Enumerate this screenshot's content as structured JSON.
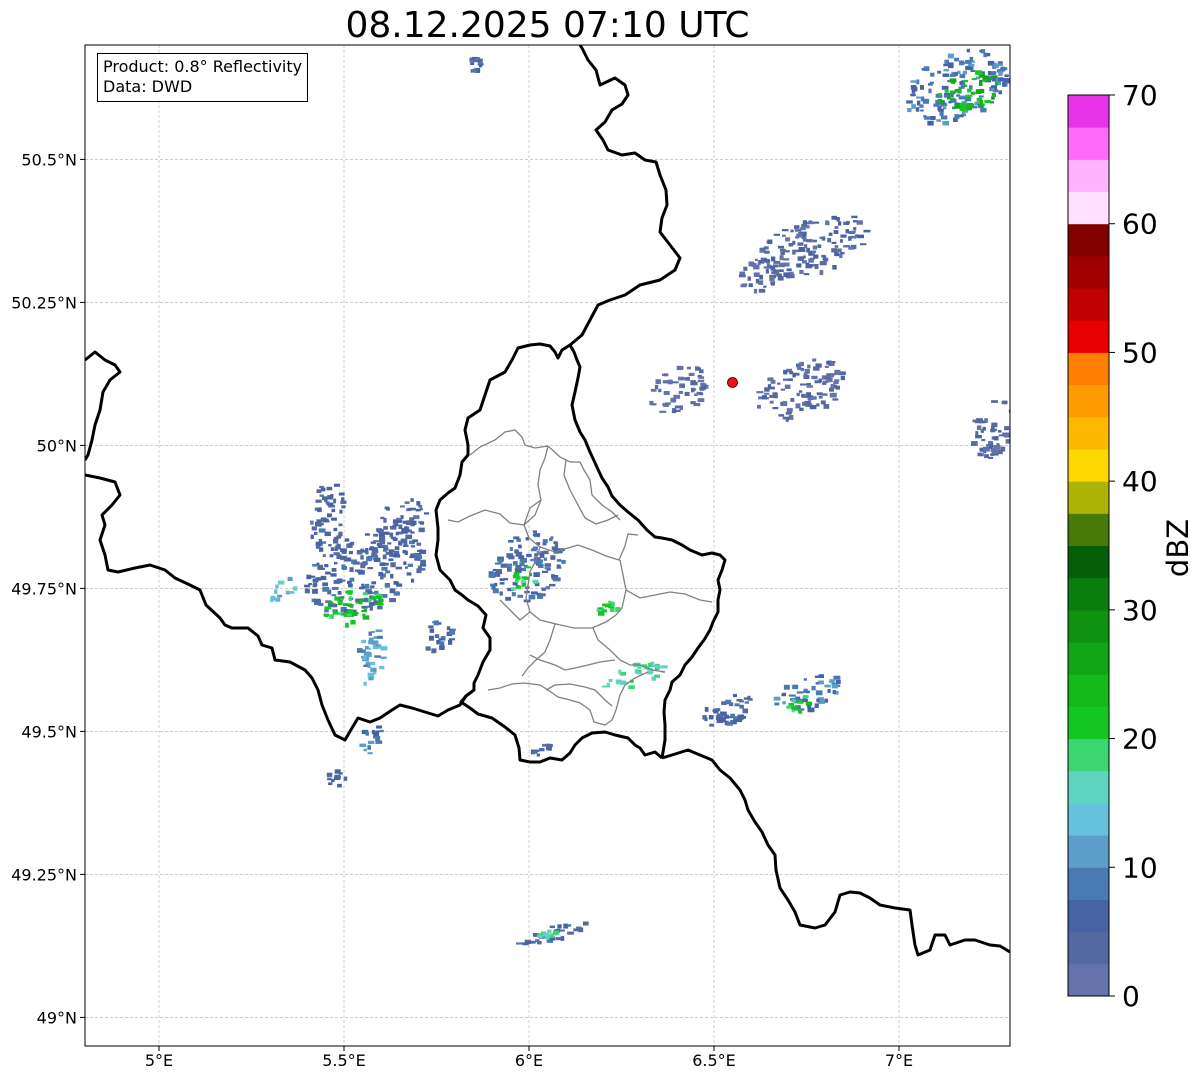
{
  "title": "08.12.2025 07:10 UTC",
  "info": {
    "product": "Product: 0.8° Reflectivity",
    "data": "Data: DWD"
  },
  "map": {
    "lon_range": [
      4.8,
      7.3
    ],
    "lat_range": [
      48.95,
      50.7
    ],
    "lon_ticks": [
      {
        "value": 5.0,
        "label": "5°E"
      },
      {
        "value": 5.5,
        "label": "5.5°E"
      },
      {
        "value": 6.0,
        "label": "6°E"
      },
      {
        "value": 6.5,
        "label": "6.5°E"
      },
      {
        "value": 7.0,
        "label": "7°E"
      }
    ],
    "lat_ticks": [
      {
        "value": 49.0,
        "label": "49°N"
      },
      {
        "value": 49.25,
        "label": "49.25°N"
      },
      {
        "value": 49.5,
        "label": "49.5°N"
      },
      {
        "value": 49.75,
        "label": "49.75°N"
      },
      {
        "value": 50.0,
        "label": "50°N"
      },
      {
        "value": 50.25,
        "label": "50.25°N"
      },
      {
        "value": 50.5,
        "label": "50.5°N"
      }
    ],
    "grid": true,
    "radar_site": {
      "lon": 6.55,
      "lat": 50.11,
      "color": "#ee1111"
    },
    "echoes": [
      {
        "lon": 5.55,
        "lat": 49.78,
        "rlon": 0.16,
        "rlat": 0.07,
        "dbz": 6
      },
      {
        "lon": 5.65,
        "lat": 49.86,
        "rlon": 0.07,
        "rlat": 0.05,
        "dbz": 4
      },
      {
        "lon": 5.45,
        "lat": 49.88,
        "rlon": 0.05,
        "rlat": 0.06,
        "dbz": 5
      },
      {
        "lon": 5.52,
        "lat": 49.72,
        "rlon": 0.08,
        "rlat": 0.03,
        "dbz": 22
      },
      {
        "lon": 5.57,
        "lat": 49.63,
        "rlon": 0.04,
        "rlat": 0.05,
        "dbz": 12
      },
      {
        "lon": 5.33,
        "lat": 49.75,
        "rlon": 0.04,
        "rlat": 0.02,
        "dbz": 14
      },
      {
        "lon": 5.75,
        "lat": 49.67,
        "rlon": 0.04,
        "rlat": 0.03,
        "dbz": 6
      },
      {
        "lon": 5.57,
        "lat": 49.49,
        "rlon": 0.03,
        "rlat": 0.03,
        "dbz": 8
      },
      {
        "lon": 5.47,
        "lat": 49.42,
        "rlon": 0.03,
        "rlat": 0.015,
        "dbz": 5
      },
      {
        "lon": 5.99,
        "lat": 49.79,
        "rlon": 0.1,
        "rlat": 0.06,
        "dbz": 6
      },
      {
        "lon": 5.98,
        "lat": 49.77,
        "rlon": 0.04,
        "rlat": 0.02,
        "dbz": 20
      },
      {
        "lon": 6.21,
        "lat": 49.72,
        "rlon": 0.03,
        "rlat": 0.01,
        "dbz": 20
      },
      {
        "lon": 6.28,
        "lat": 49.6,
        "rlon": 0.09,
        "rlat": 0.02,
        "dbz": 18
      },
      {
        "lon": 6.53,
        "lat": 49.54,
        "rlon": 0.09,
        "rlat": 0.025,
        "dbz": 6
      },
      {
        "lon": 6.75,
        "lat": 49.57,
        "rlon": 0.09,
        "rlat": 0.03,
        "dbz": 8
      },
      {
        "lon": 6.72,
        "lat": 49.55,
        "rlon": 0.03,
        "rlat": 0.015,
        "dbz": 20
      },
      {
        "lon": 6.03,
        "lat": 49.47,
        "rlon": 0.03,
        "rlat": 0.01,
        "dbz": 5
      },
      {
        "lon": 6.05,
        "lat": 49.15,
        "rlon": 0.1,
        "rlat": 0.015,
        "dbz": 6
      },
      {
        "lon": 6.04,
        "lat": 49.15,
        "rlon": 0.03,
        "rlat": 0.008,
        "dbz": 18
      },
      {
        "lon": 6.76,
        "lat": 50.35,
        "rlon": 0.15,
        "rlat": 0.05,
        "dbz": 4
      },
      {
        "lon": 6.62,
        "lat": 50.3,
        "rlon": 0.06,
        "rlat": 0.03,
        "dbz": 3
      },
      {
        "lon": 6.73,
        "lat": 50.1,
        "rlon": 0.12,
        "rlat": 0.05,
        "dbz": 3
      },
      {
        "lon": 6.4,
        "lat": 50.1,
        "rlon": 0.08,
        "rlat": 0.04,
        "dbz": 2
      },
      {
        "lon": 7.25,
        "lat": 50.03,
        "rlon": 0.06,
        "rlat": 0.05,
        "dbz": 4
      },
      {
        "lon": 7.15,
        "lat": 50.63,
        "rlon": 0.14,
        "rlat": 0.06,
        "dbz": 8
      },
      {
        "lon": 7.18,
        "lat": 50.62,
        "rlon": 0.08,
        "rlat": 0.035,
        "dbz": 24
      },
      {
        "lon": 5.85,
        "lat": 50.67,
        "rlon": 0.02,
        "rlat": 0.015,
        "dbz": 5
      }
    ]
  },
  "colorbar": {
    "label": "dBZ",
    "min": 0,
    "max": 70,
    "step": 2.5,
    "ticks": [
      {
        "value": 0,
        "label": "0"
      },
      {
        "value": 10,
        "label": "10"
      },
      {
        "value": 20,
        "label": "20"
      },
      {
        "value": 30,
        "label": "30"
      },
      {
        "value": 40,
        "label": "40"
      },
      {
        "value": 50,
        "label": "50"
      },
      {
        "value": 60,
        "label": "60"
      },
      {
        "value": 70,
        "label": "70"
      }
    ],
    "colors": [
      "#6473a9",
      "#54699f",
      "#4663a5",
      "#4a7ab4",
      "#5c9ec9",
      "#66c1dd",
      "#5fd4c2",
      "#3bd671",
      "#13c823",
      "#14b91a",
      "#10a615",
      "#0e9210",
      "#0a7b0e",
      "#055f08",
      "#487a08",
      "#aeb406",
      "#fdd700",
      "#fdb900",
      "#fe9b00",
      "#fe7f01",
      "#e80000",
      "#c10000",
      "#a00000",
      "#820000",
      "#ffe0ff",
      "#ffb3ff",
      "#ff6afb",
      "#e833e8"
    ]
  }
}
